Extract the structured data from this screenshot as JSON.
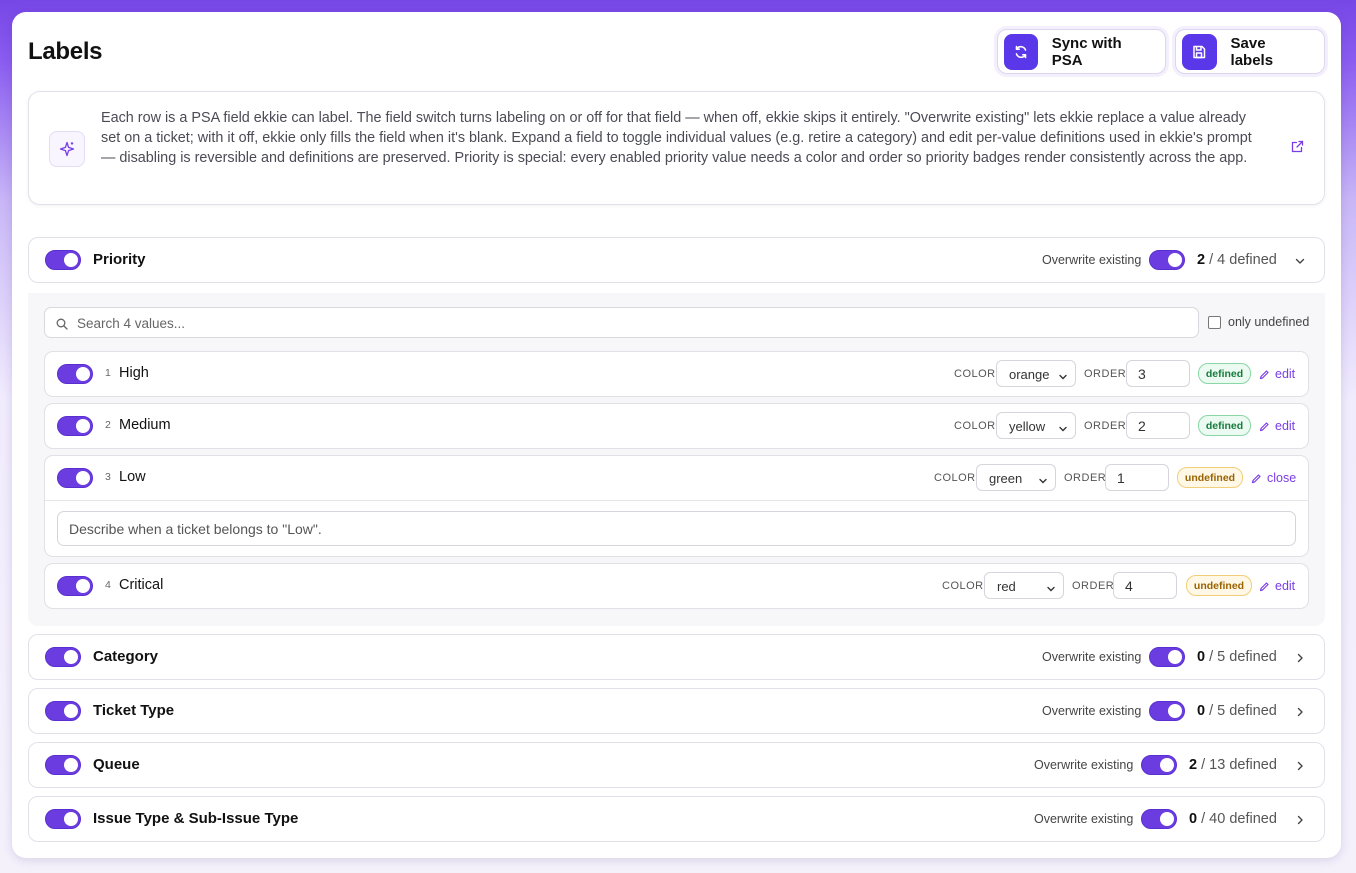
{
  "header": {
    "title": "Labels",
    "sync_label": "Sync with PSA",
    "save_label": "Save labels"
  },
  "info": {
    "text": "Each row is a PSA field ekkie can label. The field switch turns labeling on or off for that field — when off, ekkie skips it entirely. \"Overwrite existing\" lets ekkie replace a value already set on a ticket; with it off, ekkie only fills the field when it's blank. Expand a field to toggle individual values (e.g. retire a category) and edit per-value definitions used in ekkie's prompt — disabling is reversible and definitions are preserved. Priority is special: every enabled priority value needs a color and order so priority badges render consistently across the app."
  },
  "labels": {
    "overwrite": "Overwrite existing",
    "color": "COLOR",
    "order": "ORDER",
    "only_undefined": "only undefined"
  },
  "fields": [
    {
      "name": "Priority",
      "defined": "2",
      "total": "/ 4 defined",
      "enabled": true,
      "overwrite": true,
      "expanded": true
    },
    {
      "name": "Category",
      "defined": "0",
      "total": "/ 5 defined",
      "enabled": true,
      "overwrite": true,
      "expanded": false
    },
    {
      "name": "Ticket Type",
      "defined": "0",
      "total": "/ 5 defined",
      "enabled": true,
      "overwrite": true,
      "expanded": false
    },
    {
      "name": "Queue",
      "defined": "2",
      "total": "/ 13 defined",
      "enabled": true,
      "overwrite": true,
      "expanded": false
    },
    {
      "name": "Issue Type & Sub-Issue Type",
      "defined": "0",
      "total": "/ 40 defined",
      "enabled": true,
      "overwrite": true,
      "expanded": false
    }
  ],
  "priority_panel": {
    "search_placeholder": "Search 4 values...",
    "values": [
      {
        "index": "1",
        "name": "High",
        "color": "orange",
        "order": "3",
        "status": "defined",
        "action": "edit"
      },
      {
        "index": "2",
        "name": "Medium",
        "color": "yellow",
        "order": "2",
        "status": "defined",
        "action": "edit"
      },
      {
        "index": "3",
        "name": "Low",
        "color": "green",
        "order": "1",
        "status": "undefined",
        "action": "close",
        "description_placeholder": "Describe when a ticket belongs to \"Low\"."
      },
      {
        "index": "4",
        "name": "Critical",
        "color": "red",
        "order": "4",
        "status": "undefined",
        "action": "edit"
      }
    ]
  },
  "colors": {
    "accent": "#6b3de0",
    "header_gradient_top": "#7747e6",
    "defined_badge": "#177b3e",
    "undefined_badge": "#9a6200"
  }
}
